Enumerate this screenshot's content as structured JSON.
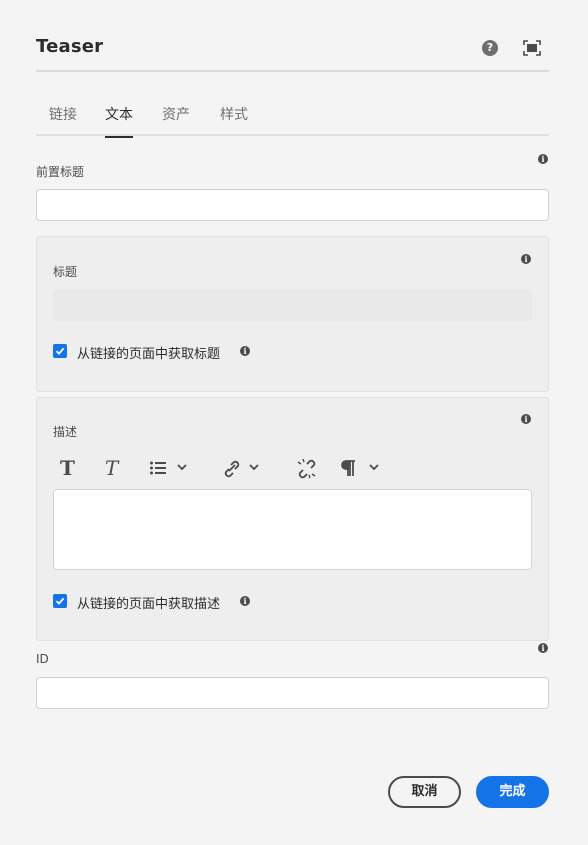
{
  "dialog": {
    "title": "Teaser",
    "help_icon_text": "?"
  },
  "tabs": [
    {
      "label": "链接",
      "active": false
    },
    {
      "label": "文本",
      "active": true
    },
    {
      "label": "资产",
      "active": false
    },
    {
      "label": "样式",
      "active": false
    }
  ],
  "pretitle": {
    "label": "前置标题",
    "value": ""
  },
  "title_panel": {
    "label": "标题",
    "value": "",
    "checkbox_label": "从链接的页面中获取标题",
    "checked": true
  },
  "description_panel": {
    "label": "描述",
    "toolbar": [
      "bold-icon",
      "italic-icon",
      "list-icon",
      "link-icon",
      "unlink-icon",
      "paragraph-format-icon"
    ],
    "value": "",
    "checkbox_label": "从链接的页面中获取描述",
    "checked": true
  },
  "id_field": {
    "label": "ID",
    "value": ""
  },
  "info_icon_text": "i",
  "buttons": {
    "cancel": "取消",
    "done": "完成"
  },
  "colors": {
    "accent": "#1473e6",
    "background": "#f4f4f4"
  }
}
